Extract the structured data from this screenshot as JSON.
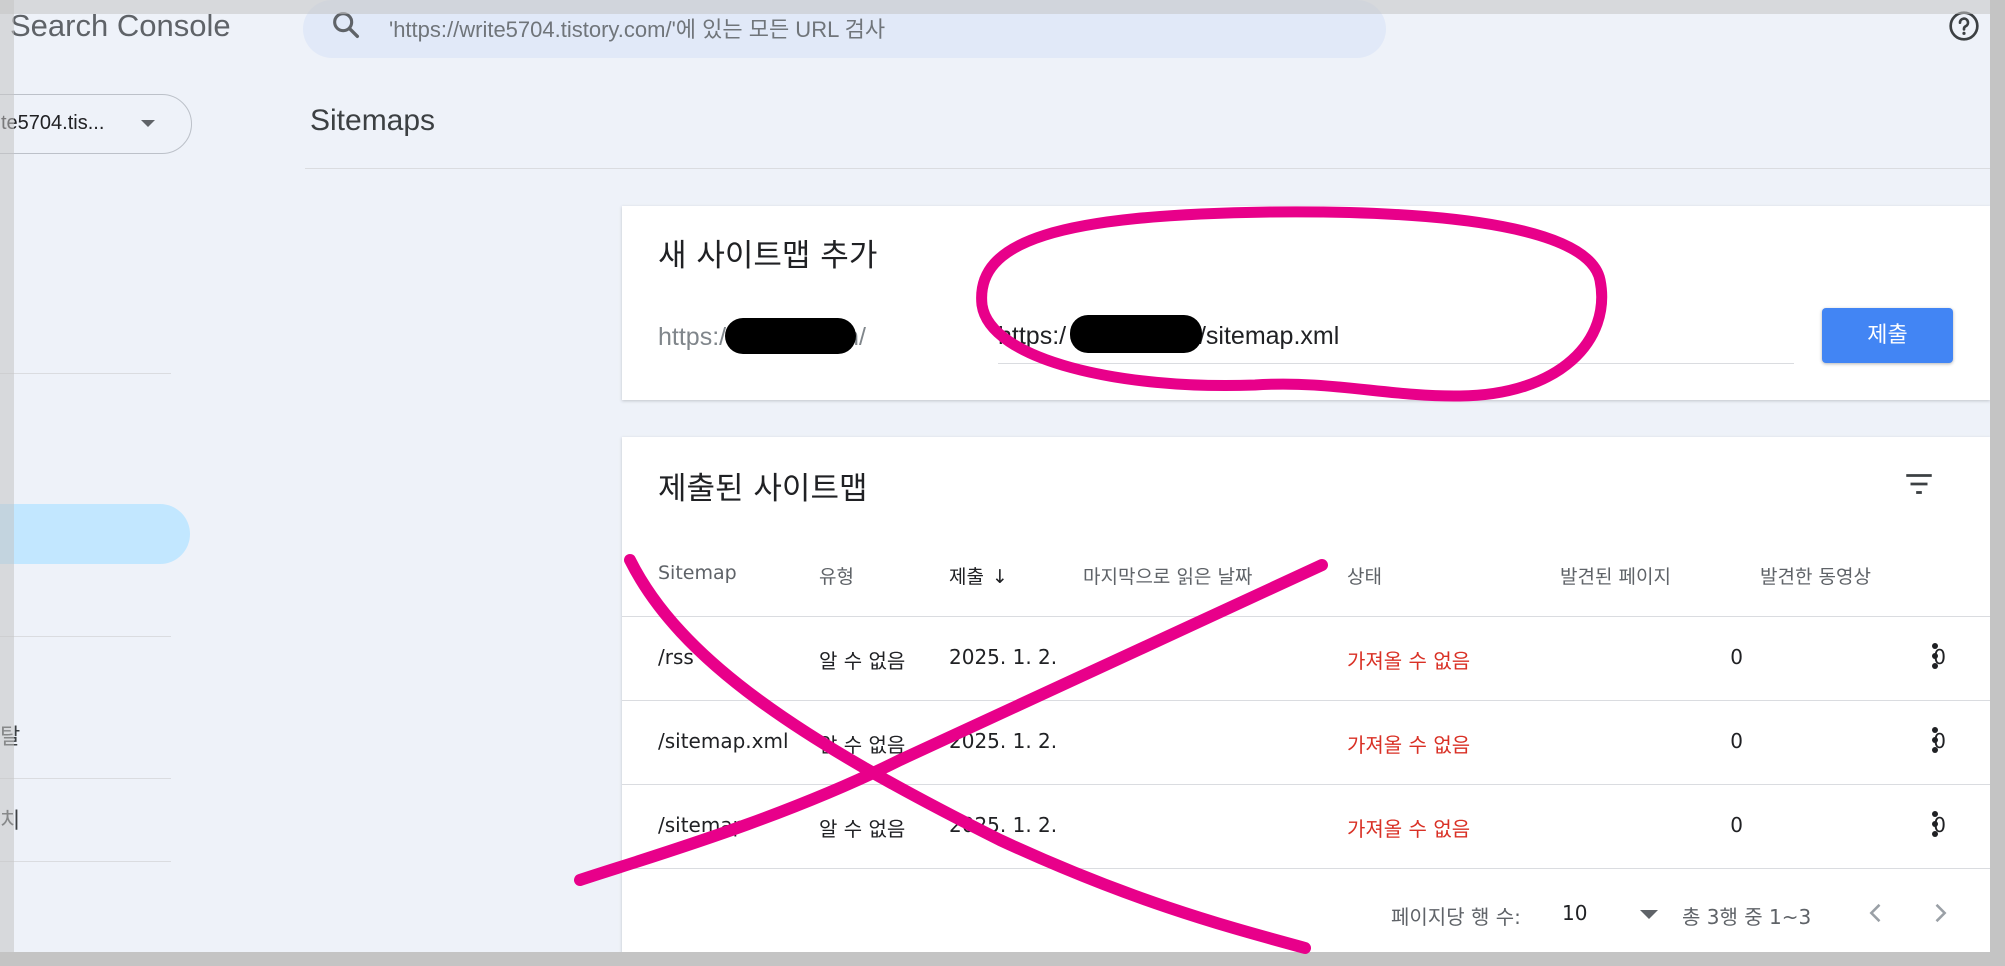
{
  "app": {
    "title": "Search Console"
  },
  "search": {
    "placeholder": "'https://write5704.tistory.com/'에 있는 모든 URL 검사"
  },
  "property": {
    "label": "te5704.tis..."
  },
  "sidebar": {
    "partial_items": [
      "탈",
      "치"
    ]
  },
  "page": {
    "title": "Sitemaps"
  },
  "add_sitemap": {
    "title": "새 사이트맵 추가",
    "prefix": "https:/ .tistory.com/",
    "input_value": "https:/ .tistory.com/sitemap.xml",
    "submit_label": "제출"
  },
  "submitted": {
    "title": "제출된 사이트맵",
    "columns": [
      "Sitemap",
      "유형",
      "제출",
      "마지막으로 읽은 날짜",
      "상태",
      "발견된 페이지",
      "발견한 동영상"
    ],
    "sort_arrow": "↓",
    "rows": [
      {
        "sitemap": "/rss",
        "type": "알 수 없음",
        "submitted": "2025. 1. 2.",
        "last_read": "",
        "status": "가져올 수 없음",
        "pages": "0",
        "videos": "0"
      },
      {
        "sitemap": "/sitemap.xml",
        "type": "알 수 없음",
        "submitted": "2025. 1. 2.",
        "last_read": "",
        "status": "가져올 수 없음",
        "pages": "0",
        "videos": "0"
      },
      {
        "sitemap": "/sitemap",
        "type": "알 수 없음",
        "submitted": "2025. 1. 2.",
        "last_read": "",
        "status": "가져올 수 없음",
        "pages": "0",
        "videos": "0"
      }
    ],
    "pager": {
      "rows_per_page_label": "페이지당 행 수:",
      "rows_per_page": "10",
      "range": "총 3행 중 1~3"
    }
  },
  "colors": {
    "accent": "#4285f4",
    "error": "#d93025",
    "annotation": "#e8008a",
    "nav_active": "#c2e7ff"
  }
}
